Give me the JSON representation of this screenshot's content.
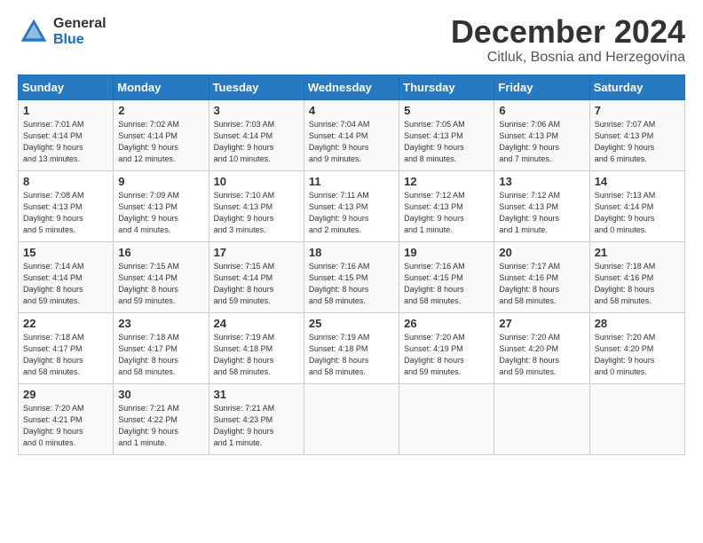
{
  "logo": {
    "general": "General",
    "blue": "Blue"
  },
  "title": "December 2024",
  "subtitle": "Citluk, Bosnia and Herzegovina",
  "days_of_week": [
    "Sunday",
    "Monday",
    "Tuesday",
    "Wednesday",
    "Thursday",
    "Friday",
    "Saturday"
  ],
  "weeks": [
    [
      {
        "day": "1",
        "info": "Sunrise: 7:01 AM\nSunset: 4:14 PM\nDaylight: 9 hours\nand 13 minutes."
      },
      {
        "day": "2",
        "info": "Sunrise: 7:02 AM\nSunset: 4:14 PM\nDaylight: 9 hours\nand 12 minutes."
      },
      {
        "day": "3",
        "info": "Sunrise: 7:03 AM\nSunset: 4:14 PM\nDaylight: 9 hours\nand 10 minutes."
      },
      {
        "day": "4",
        "info": "Sunrise: 7:04 AM\nSunset: 4:14 PM\nDaylight: 9 hours\nand 9 minutes."
      },
      {
        "day": "5",
        "info": "Sunrise: 7:05 AM\nSunset: 4:13 PM\nDaylight: 9 hours\nand 8 minutes."
      },
      {
        "day": "6",
        "info": "Sunrise: 7:06 AM\nSunset: 4:13 PM\nDaylight: 9 hours\nand 7 minutes."
      },
      {
        "day": "7",
        "info": "Sunrise: 7:07 AM\nSunset: 4:13 PM\nDaylight: 9 hours\nand 6 minutes."
      }
    ],
    [
      {
        "day": "8",
        "info": "Sunrise: 7:08 AM\nSunset: 4:13 PM\nDaylight: 9 hours\nand 5 minutes."
      },
      {
        "day": "9",
        "info": "Sunrise: 7:09 AM\nSunset: 4:13 PM\nDaylight: 9 hours\nand 4 minutes."
      },
      {
        "day": "10",
        "info": "Sunrise: 7:10 AM\nSunset: 4:13 PM\nDaylight: 9 hours\nand 3 minutes."
      },
      {
        "day": "11",
        "info": "Sunrise: 7:11 AM\nSunset: 4:13 PM\nDaylight: 9 hours\nand 2 minutes."
      },
      {
        "day": "12",
        "info": "Sunrise: 7:12 AM\nSunset: 4:13 PM\nDaylight: 9 hours\nand 1 minute."
      },
      {
        "day": "13",
        "info": "Sunrise: 7:12 AM\nSunset: 4:13 PM\nDaylight: 9 hours\nand 1 minute."
      },
      {
        "day": "14",
        "info": "Sunrise: 7:13 AM\nSunset: 4:14 PM\nDaylight: 9 hours\nand 0 minutes."
      }
    ],
    [
      {
        "day": "15",
        "info": "Sunrise: 7:14 AM\nSunset: 4:14 PM\nDaylight: 8 hours\nand 59 minutes."
      },
      {
        "day": "16",
        "info": "Sunrise: 7:15 AM\nSunset: 4:14 PM\nDaylight: 8 hours\nand 59 minutes."
      },
      {
        "day": "17",
        "info": "Sunrise: 7:15 AM\nSunset: 4:14 PM\nDaylight: 8 hours\nand 59 minutes."
      },
      {
        "day": "18",
        "info": "Sunrise: 7:16 AM\nSunset: 4:15 PM\nDaylight: 8 hours\nand 58 minutes."
      },
      {
        "day": "19",
        "info": "Sunrise: 7:16 AM\nSunset: 4:15 PM\nDaylight: 8 hours\nand 58 minutes."
      },
      {
        "day": "20",
        "info": "Sunrise: 7:17 AM\nSunset: 4:16 PM\nDaylight: 8 hours\nand 58 minutes."
      },
      {
        "day": "21",
        "info": "Sunrise: 7:18 AM\nSunset: 4:16 PM\nDaylight: 8 hours\nand 58 minutes."
      }
    ],
    [
      {
        "day": "22",
        "info": "Sunrise: 7:18 AM\nSunset: 4:17 PM\nDaylight: 8 hours\nand 58 minutes."
      },
      {
        "day": "23",
        "info": "Sunrise: 7:18 AM\nSunset: 4:17 PM\nDaylight: 8 hours\nand 58 minutes."
      },
      {
        "day": "24",
        "info": "Sunrise: 7:19 AM\nSunset: 4:18 PM\nDaylight: 8 hours\nand 58 minutes."
      },
      {
        "day": "25",
        "info": "Sunrise: 7:19 AM\nSunset: 4:18 PM\nDaylight: 8 hours\nand 58 minutes."
      },
      {
        "day": "26",
        "info": "Sunrise: 7:20 AM\nSunset: 4:19 PM\nDaylight: 8 hours\nand 59 minutes."
      },
      {
        "day": "27",
        "info": "Sunrise: 7:20 AM\nSunset: 4:20 PM\nDaylight: 8 hours\nand 59 minutes."
      },
      {
        "day": "28",
        "info": "Sunrise: 7:20 AM\nSunset: 4:20 PM\nDaylight: 9 hours\nand 0 minutes."
      }
    ],
    [
      {
        "day": "29",
        "info": "Sunrise: 7:20 AM\nSunset: 4:21 PM\nDaylight: 9 hours\nand 0 minutes."
      },
      {
        "day": "30",
        "info": "Sunrise: 7:21 AM\nSunset: 4:22 PM\nDaylight: 9 hours\nand 1 minute."
      },
      {
        "day": "31",
        "info": "Sunrise: 7:21 AM\nSunset: 4:23 PM\nDaylight: 9 hours\nand 1 minute."
      },
      {
        "day": "",
        "info": ""
      },
      {
        "day": "",
        "info": ""
      },
      {
        "day": "",
        "info": ""
      },
      {
        "day": "",
        "info": ""
      }
    ]
  ]
}
